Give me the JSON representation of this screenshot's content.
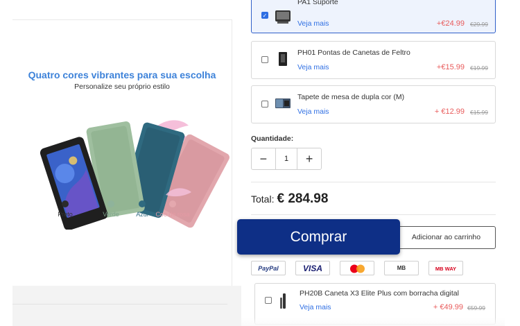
{
  "promo": {
    "title": "Quatro cores vibrantes para sua escolha",
    "subtitle": "Personalize seu próprio estilo",
    "swatches": [
      {
        "label": "Preto",
        "color": "#2b2b2b",
        "text_color": "#333333"
      },
      {
        "label": "Verde",
        "color": "#8fb39b",
        "text_color": "#7fa58d"
      },
      {
        "label": "Azul",
        "color": "#2f6a80",
        "text_color": "#2f6a80"
      },
      {
        "label": "Coe de rosa",
        "color": "#e4a8ae",
        "text_color": "#e49aa4"
      }
    ]
  },
  "addons": [
    {
      "name": "PA1 Suporte",
      "more": "Veja mais",
      "price": "+€24.99",
      "old_price": "€29.99",
      "checked": true
    },
    {
      "name": "PH01 Pontas de Canetas de Feltro",
      "more": "Veja mais",
      "price": "+€15.99",
      "old_price": "€19.99",
      "checked": false
    },
    {
      "name": "Tapete de mesa de dupla cor (M)",
      "more": "Veja mais",
      "price": "+ €12.99",
      "old_price": "€15.99",
      "checked": false
    }
  ],
  "quantity": {
    "label": "Quantidade:",
    "minus": "−",
    "value": "1",
    "plus": "+"
  },
  "total": {
    "label": "Total:",
    "amount": "€ 284.98"
  },
  "actions": {
    "buy": "Comprar",
    "add_to_cart": "Adicionar ao carrinho"
  },
  "payments": [
    {
      "label": "PayPal",
      "color": "#253b80"
    },
    {
      "label": "VISA",
      "color": "#1a1f71"
    },
    {
      "label": "mastercard",
      "color": "#eb001b"
    },
    {
      "label": "MB",
      "color": "#333333"
    },
    {
      "label": "MB WAY",
      "color": "#d6001c"
    }
  ],
  "bottom_item": {
    "name": "PH20B Caneta X3 Elite Plus com borracha digital",
    "more": "Veja mais",
    "price": "+ €49.99",
    "old_price": "€59.99"
  },
  "colors": {
    "accent": "#2f6fe3",
    "buy_button": "#0e2f86",
    "price": "#e85a5a",
    "selected_border": "#2f5fc9"
  }
}
